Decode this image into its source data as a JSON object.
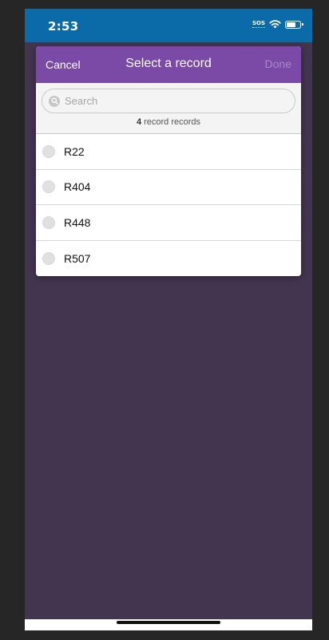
{
  "status_bar": {
    "time": "2:53",
    "sos_label": "SOS",
    "icons": [
      "wifi-icon",
      "battery-icon"
    ]
  },
  "modal": {
    "cancel_label": "Cancel",
    "title": "Select a record",
    "done_label": "Done",
    "search": {
      "placeholder": "Search",
      "value": ""
    },
    "record_count": {
      "number": "4",
      "text": "record records"
    },
    "records": [
      {
        "label": "R22",
        "selected": false
      },
      {
        "label": "R404",
        "selected": false
      },
      {
        "label": "R448",
        "selected": false
      },
      {
        "label": "R507",
        "selected": false
      }
    ]
  },
  "colors": {
    "status_bar": "#0b6aa8",
    "header": "#7a4aa6",
    "backdrop": "#43344f",
    "done_disabled": "#a888c4"
  }
}
